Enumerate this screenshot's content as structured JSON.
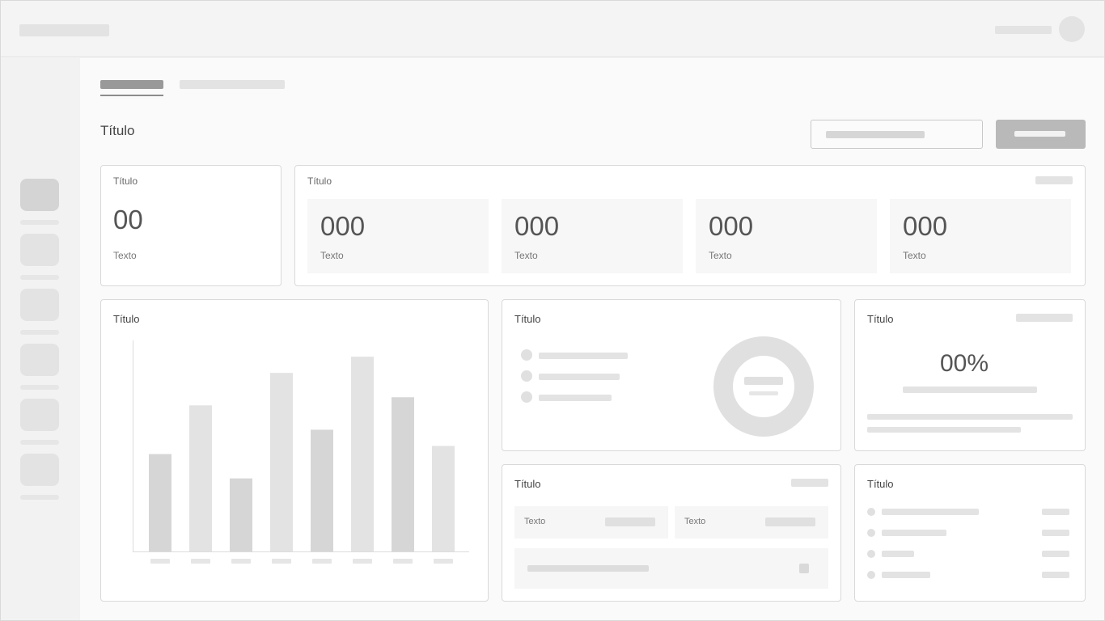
{
  "main": {
    "page_title": "Título"
  },
  "summary_card": {
    "title": "Título",
    "value": "00",
    "label": "Texto"
  },
  "stats_card": {
    "title": "Título",
    "tiles": [
      {
        "value": "000",
        "label": "Texto"
      },
      {
        "value": "000",
        "label": "Texto"
      },
      {
        "value": "000",
        "label": "Texto"
      },
      {
        "value": "000",
        "label": "Texto"
      }
    ]
  },
  "bar_card": {
    "title": "Título"
  },
  "donut_card": {
    "title": "Título"
  },
  "percent_card": {
    "title": "Título",
    "value": "00%"
  },
  "detail_card": {
    "title": "Título",
    "field_1_label": "Texto",
    "field_2_label": "Texto"
  },
  "list_card": {
    "title": "Título"
  },
  "chart_data": {
    "type": "bar",
    "categories": [
      "",
      "",
      "",
      "",
      "",
      "",
      "",
      ""
    ],
    "values": [
      120,
      180,
      90,
      220,
      150,
      240,
      190,
      130
    ],
    "bar_colors": [
      "#d6d6d6",
      "#e3e3e3",
      "#d6d6d6",
      "#e3e3e3",
      "#d6d6d6",
      "#e3e3e3",
      "#d6d6d6",
      "#e3e3e3"
    ],
    "ylim": [
      0,
      260
    ],
    "grid": false,
    "legend": "none"
  },
  "colors": {
    "placeholder": "#e3e3e3",
    "placeholder_dark": "#d6d6d6",
    "primary_button": "#b9b9b9",
    "border": "#d9d9d9"
  }
}
